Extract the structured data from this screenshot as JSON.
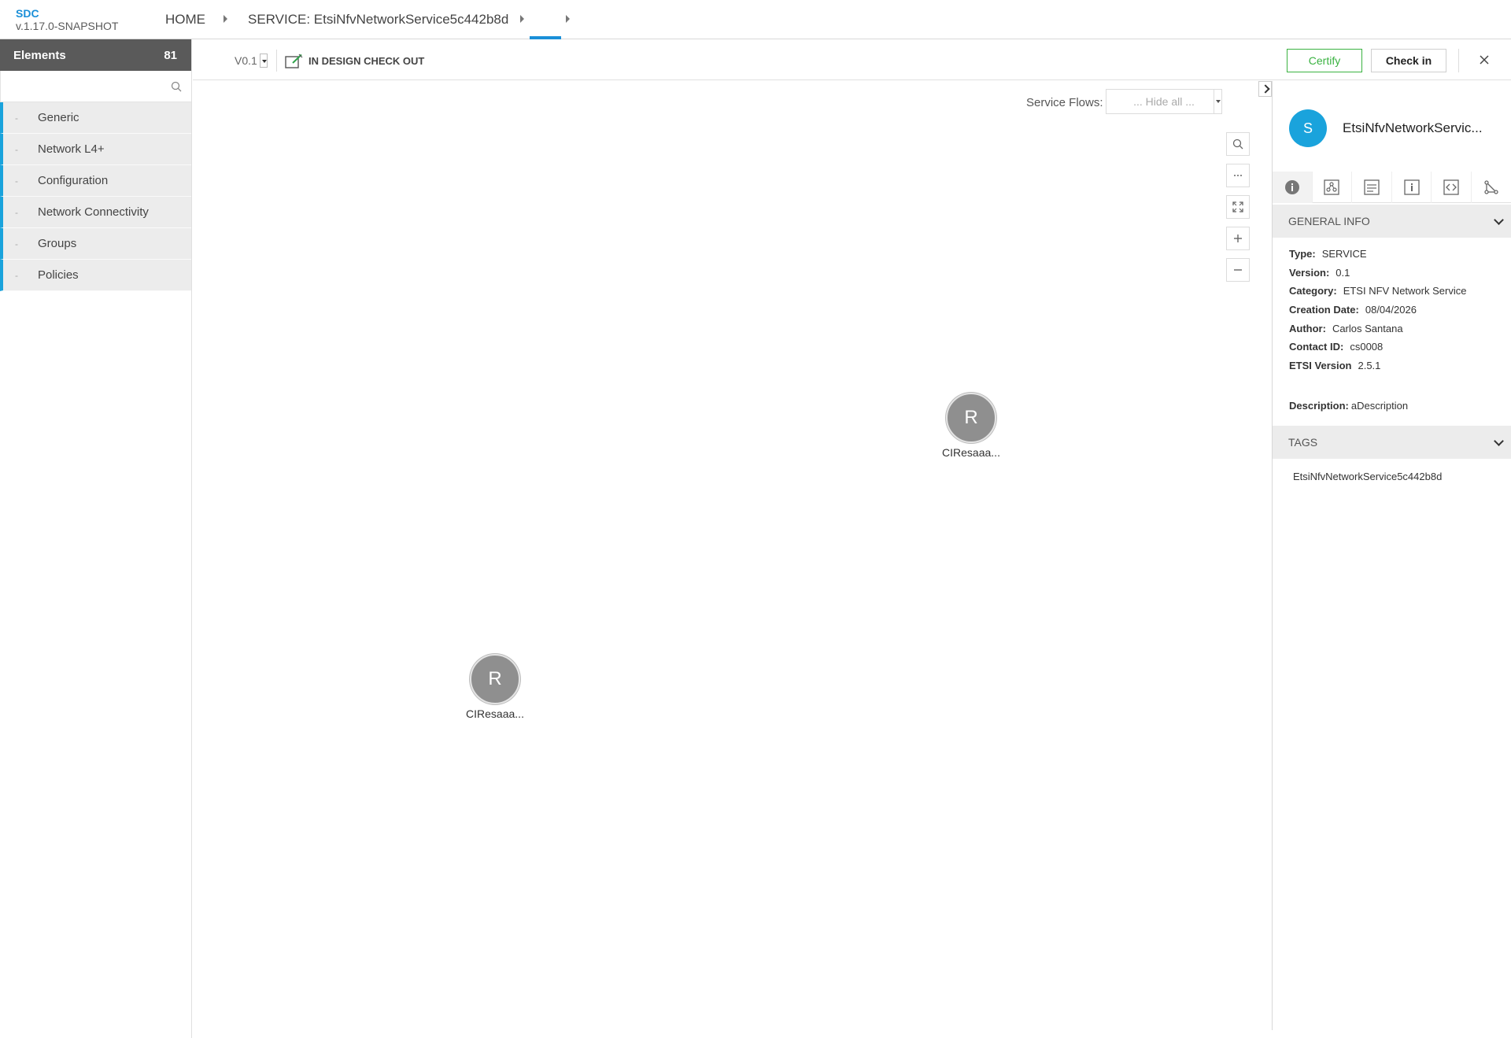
{
  "header": {
    "brand_name": "SDC",
    "brand_version": "v.1.17.0-SNAPSHOT",
    "breadcrumb_home": "HOME",
    "breadcrumb_service": "SERVICE: EtsiNfvNetworkService5c442b8d"
  },
  "palette": {
    "title": "Elements",
    "count": "81",
    "search_placeholder": "",
    "categories": [
      {
        "label": "Generic"
      },
      {
        "label": "Network L4+"
      },
      {
        "label": "Configuration"
      },
      {
        "label": "Network Connectivity"
      },
      {
        "label": "Groups"
      },
      {
        "label": "Policies"
      }
    ]
  },
  "toolbar": {
    "version": "V0.1",
    "status": "IN DESIGN CHECK OUT",
    "certify_label": "Certify",
    "checkin_label": "Check in"
  },
  "canvas": {
    "service_flows_label": "Service Flows:",
    "service_flows_value": "... Hide all ...",
    "nodes": [
      {
        "letter": "R",
        "label": "CIResaaa..."
      },
      {
        "letter": "R",
        "label": "CIResaaa..."
      }
    ]
  },
  "right_panel": {
    "avatar_letter": "S",
    "title": "EtsiNfvNetworkServic...",
    "tabs": [
      "info-icon",
      "composition-icon",
      "deployment-artifacts-icon",
      "properties-icon",
      "api-icon",
      "workflow-icon"
    ],
    "general_info_title": "GENERAL INFO",
    "info": [
      {
        "label": "Type:",
        "value": "SERVICE"
      },
      {
        "label": "Version:",
        "value": "0.1"
      },
      {
        "label": "Category:",
        "value": "ETSI NFV Network Service"
      },
      {
        "label": "Creation Date:",
        "value": "08/04/2026"
      },
      {
        "label": "Author:",
        "value": "Carlos Santana"
      },
      {
        "label": "Contact ID:",
        "value": "cs0008"
      },
      {
        "label": "ETSI Version",
        "value": "2.5.1"
      }
    ],
    "description_label": "Description:",
    "description_value": "aDescription",
    "tags_title": "TAGS",
    "tags": [
      "EtsiNfvNetworkService5c442b8d"
    ]
  },
  "colors": {
    "accent": "#1aa3dc",
    "brand": "#1a8fd8",
    "certify": "#3ab241",
    "palette_header": "#5a5a5a",
    "node_fill": "#8f8f8f"
  }
}
